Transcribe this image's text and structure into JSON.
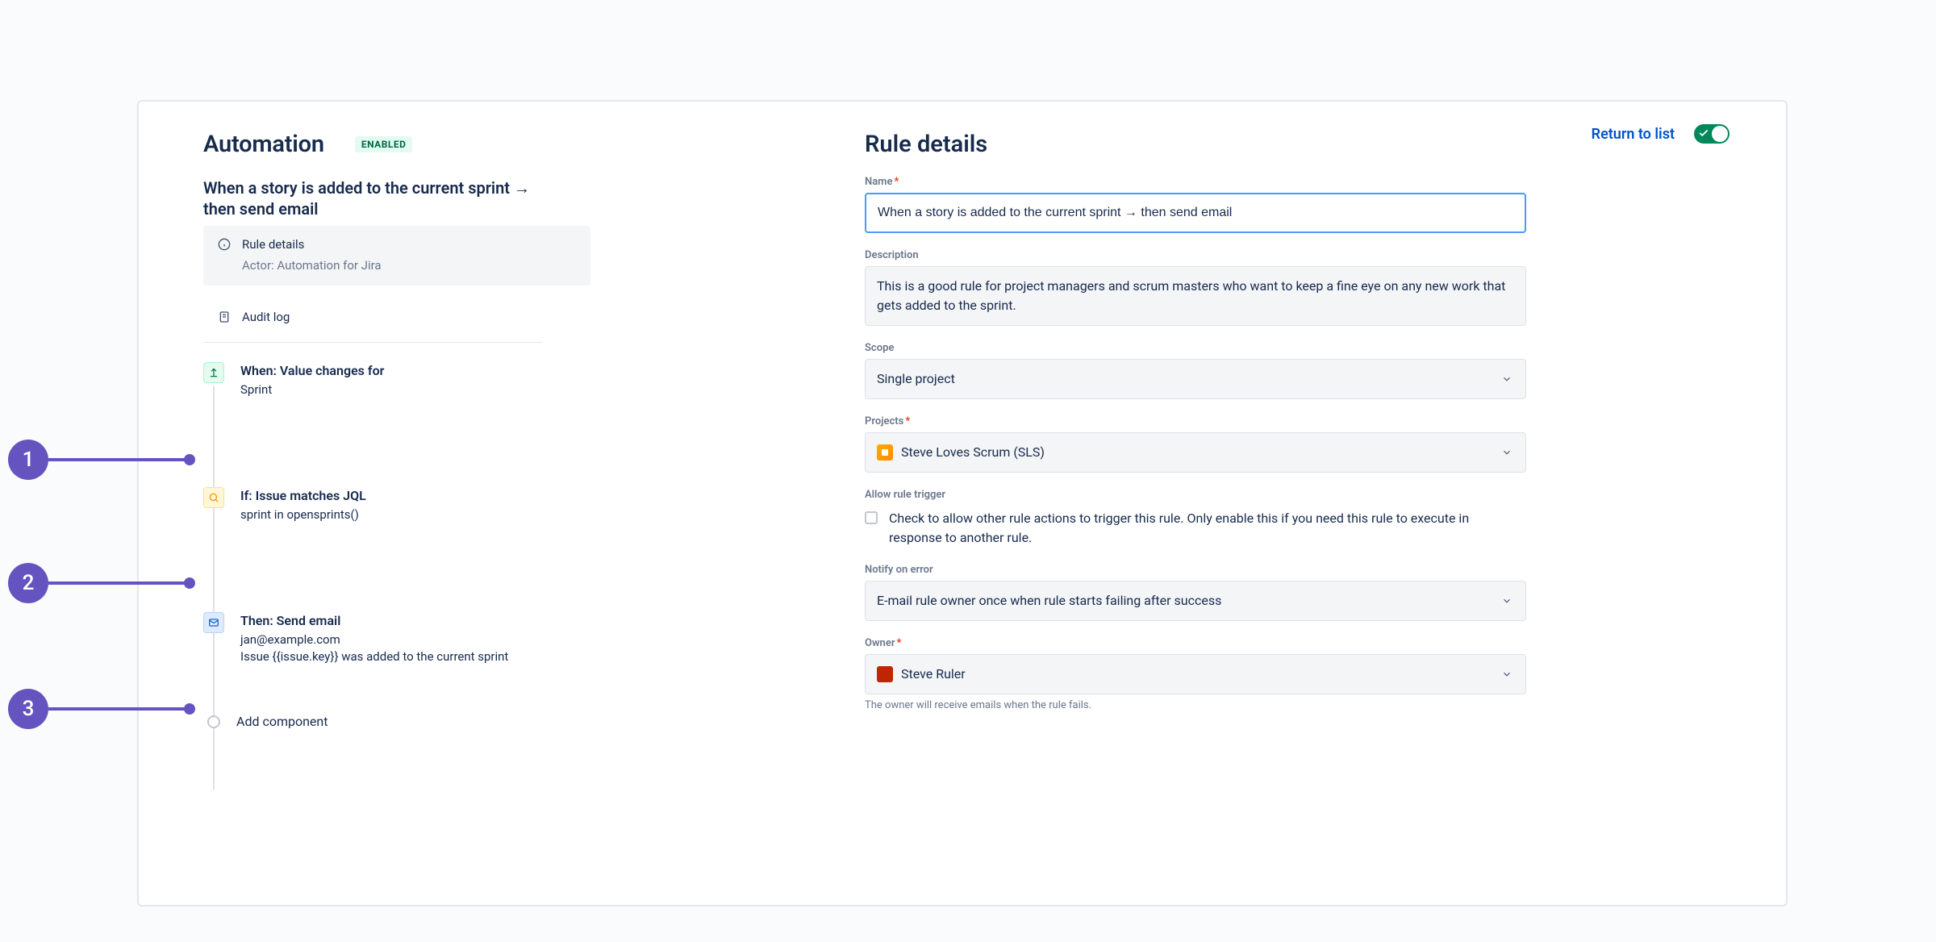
{
  "header": {
    "title": "Automation",
    "status_badge": "ENABLED",
    "return_link": "Return to list"
  },
  "rule_summary": {
    "name": "When a story is added to the current sprint → then send email",
    "details_label": "Rule details",
    "actor_label": "Actor: Automation for Jira",
    "audit_log": "Audit log"
  },
  "steps": [
    {
      "title": "When: Value changes for",
      "sub": "Sprint"
    },
    {
      "title": "If: Issue matches JQL",
      "sub": "sprint in opensprints()"
    },
    {
      "title": "Then: Send email",
      "sub": "jan@example.com\nIssue {{issue.key}} was added to the current sprint"
    }
  ],
  "add_component": "Add component",
  "details": {
    "heading": "Rule details",
    "name_label": "Name",
    "name_value": "When a story is added to the current sprint → then send email",
    "description_label": "Description",
    "description_value": "This is a good rule for project managers and scrum masters who want to keep a fine eye on any new work that gets added to the sprint.",
    "scope_label": "Scope",
    "scope_value": "Single project",
    "projects_label": "Projects",
    "projects_value": "Steve Loves Scrum (SLS)",
    "allow_trigger_label": "Allow rule trigger",
    "allow_trigger_text": "Check to allow other rule actions to trigger this rule. Only enable this if you need this rule to execute in response to another rule.",
    "notify_label": "Notify on error",
    "notify_value": "E-mail rule owner once when rule starts failing after success",
    "owner_label": "Owner",
    "owner_value": "Steve Ruler",
    "owner_help": "The owner will receive emails when the rule fails."
  },
  "callouts": [
    "1",
    "2",
    "3"
  ]
}
